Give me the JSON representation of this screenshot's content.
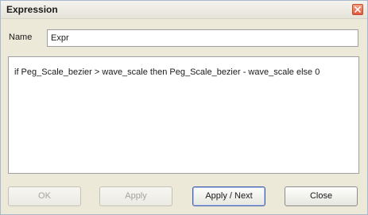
{
  "window": {
    "title": "Expression"
  },
  "name_field": {
    "label": "Name",
    "value": "Expr"
  },
  "expression": {
    "text": "if Peg_Scale_bezier > wave_scale then Peg_Scale_bezier - wave_scale else 0"
  },
  "buttons": {
    "ok": "OK",
    "apply": "Apply",
    "apply_next": "Apply / Next",
    "close": "Close"
  },
  "icons": {
    "close": "close-icon"
  },
  "colors": {
    "close_button": "#e0593a",
    "dialog_background": "#ece9d8"
  }
}
